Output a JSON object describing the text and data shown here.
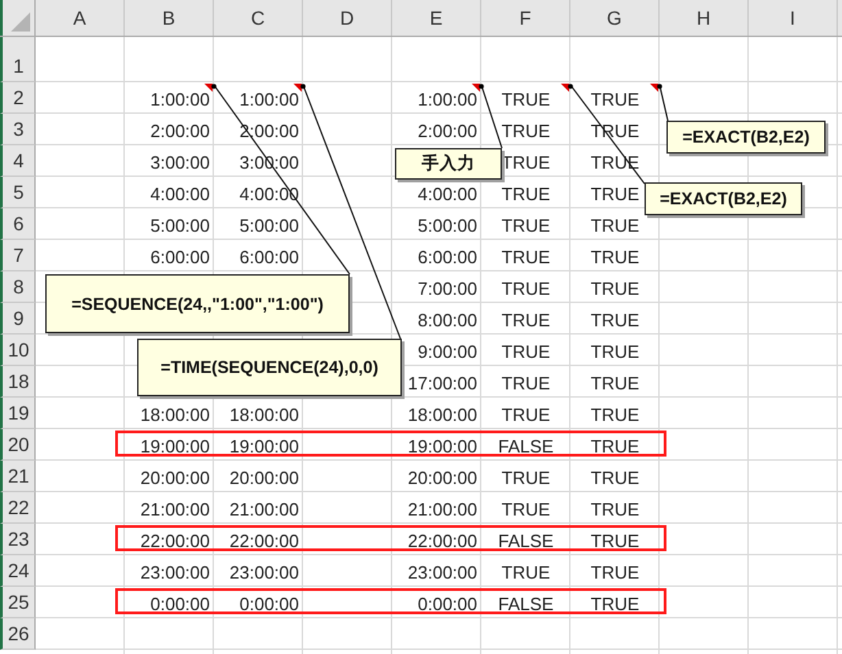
{
  "columns": [
    "A",
    "B",
    "C",
    "D",
    "E",
    "F",
    "G",
    "H",
    "I"
  ],
  "rows": [
    {
      "num": "1",
      "highlighted": false,
      "cells": {}
    },
    {
      "num": "2",
      "highlighted": false,
      "cells": {
        "b": "1:00:00",
        "c": "1:00:00",
        "e": "1:00:00",
        "f": "TRUE",
        "g": "TRUE"
      }
    },
    {
      "num": "3",
      "highlighted": false,
      "cells": {
        "b": "2:00:00",
        "c": "2:00:00",
        "e": "2:00:00",
        "f": "TRUE",
        "g": "TRUE"
      }
    },
    {
      "num": "4",
      "highlighted": false,
      "cells": {
        "b": "3:00:00",
        "c": "3:00:00",
        "f": "TRUE",
        "g": "TRUE"
      }
    },
    {
      "num": "5",
      "highlighted": false,
      "cells": {
        "b": "4:00:00",
        "c": "4:00:00",
        "e": "4:00:00",
        "f": "TRUE",
        "g": "TRUE"
      }
    },
    {
      "num": "6",
      "highlighted": false,
      "cells": {
        "b": "5:00:00",
        "c": "5:00:00",
        "e": "5:00:00",
        "f": "TRUE",
        "g": "TRUE"
      }
    },
    {
      "num": "7",
      "highlighted": false,
      "cells": {
        "b": "6:00:00",
        "c": "6:00:00",
        "e": "6:00:00",
        "f": "TRUE",
        "g": "TRUE"
      }
    },
    {
      "num": "8",
      "highlighted": false,
      "cells": {
        "e": "7:00:00",
        "f": "TRUE",
        "g": "TRUE"
      }
    },
    {
      "num": "9",
      "highlighted": false,
      "cells": {
        "e": "8:00:00",
        "f": "TRUE",
        "g": "TRUE"
      }
    },
    {
      "num": "10",
      "highlighted": false,
      "cells": {
        "e": "9:00:00",
        "f": "TRUE",
        "g": "TRUE"
      }
    },
    {
      "num": "18",
      "highlighted": false,
      "cells": {
        "e": "17:00:00",
        "f": "TRUE",
        "g": "TRUE"
      }
    },
    {
      "num": "19",
      "highlighted": false,
      "cells": {
        "b": "18:00:00",
        "c": "18:00:00",
        "e": "18:00:00",
        "f": "TRUE",
        "g": "TRUE"
      }
    },
    {
      "num": "20",
      "highlighted": true,
      "cells": {
        "b": "19:00:00",
        "c": "19:00:00",
        "e": "19:00:00",
        "f": "FALSE",
        "g": "TRUE"
      }
    },
    {
      "num": "21",
      "highlighted": false,
      "cells": {
        "b": "20:00:00",
        "c": "20:00:00",
        "e": "20:00:00",
        "f": "TRUE",
        "g": "TRUE"
      }
    },
    {
      "num": "22",
      "highlighted": false,
      "cells": {
        "b": "21:00:00",
        "c": "21:00:00",
        "e": "21:00:00",
        "f": "TRUE",
        "g": "TRUE"
      }
    },
    {
      "num": "23",
      "highlighted": true,
      "cells": {
        "b": "22:00:00",
        "c": "22:00:00",
        "e": "22:00:00",
        "f": "FALSE",
        "g": "TRUE"
      }
    },
    {
      "num": "24",
      "highlighted": false,
      "cells": {
        "b": "23:00:00",
        "c": "23:00:00",
        "e": "23:00:00",
        "f": "TRUE",
        "g": "TRUE"
      }
    },
    {
      "num": "25",
      "highlighted": true,
      "cells": {
        "b": "0:00:00",
        "c": "0:00:00",
        "e": "0:00:00",
        "f": "FALSE",
        "g": "TRUE"
      }
    },
    {
      "num": "26",
      "highlighted": false,
      "cells": {}
    }
  ],
  "notes": [
    {
      "text": "=SEQUENCE(24,,\"1:00\",\"1:00\")"
    },
    {
      "text": "=TIME(SEQUENCE(24),0,0)"
    },
    {
      "text": "手入力"
    },
    {
      "text": "=EXACT(B2,E2)"
    },
    {
      "text": "=EXACT(B2,E2)"
    }
  ]
}
